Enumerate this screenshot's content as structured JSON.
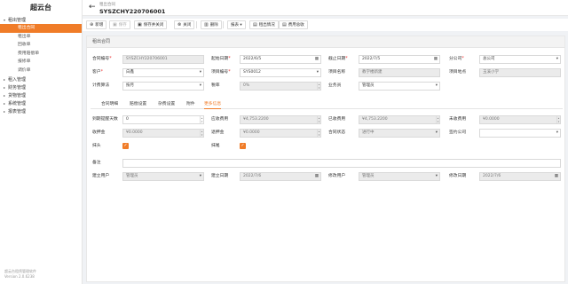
{
  "app": {
    "title": "超云台",
    "footer_line1": "超云台租赁管理软件",
    "footer_line2": "Version 2.0.6238"
  },
  "sidebar": {
    "groups": [
      {
        "label": "租出管理",
        "expanded": true
      },
      {
        "label": "租入管理",
        "expanded": false
      },
      {
        "label": "财务管理",
        "expanded": false
      },
      {
        "label": "货物管理",
        "expanded": false
      },
      {
        "label": "系统管理",
        "expanded": false
      },
      {
        "label": "报表管理",
        "expanded": false
      }
    ],
    "items": [
      {
        "label": "租出合同",
        "active": true
      },
      {
        "label": "租出单"
      },
      {
        "label": "回收单"
      },
      {
        "label": "费用赔偿单"
      },
      {
        "label": "报修单"
      },
      {
        "label": "调价单"
      }
    ]
  },
  "header": {
    "breadcrumb": "租出合同",
    "doc_no": "SYSZCHY220706001",
    "back_icon": "arrow-left-icon"
  },
  "toolbar": {
    "new": "新增",
    "save": "保存",
    "save_close": "保存并关闭",
    "close": "关闭",
    "delete": "删除",
    "print": "报表",
    "rent_status": "租出情况",
    "fee_summary": "费用总收"
  },
  "section_title": "租出合同",
  "form": {
    "contract_no_label": "合同编号",
    "contract_no": "SYSZCHY220706001",
    "start_date_label": "起始日期",
    "start_date": "2022/6/5",
    "end_date_label": "截止日期",
    "end_date": "2022/7/5",
    "branch_label": "分公司",
    "branch": "总公司",
    "customer_label": "客户",
    "customer": "白鑫",
    "project_no_label": "项目编号",
    "project_no": "SYS0012",
    "project_name_label": "项目名称",
    "project_name": "教学楼新建",
    "project_site_label": "项目地点",
    "project_site": "玉溪小学",
    "billing_label": "计费算法",
    "billing": "按月",
    "tax_label": "税率",
    "tax": "0%",
    "salesman_label": "业务员",
    "salesman": "管理员"
  },
  "tabs": [
    "合同明细",
    "赔偿设置",
    "杂费设置",
    "附件",
    "更多信息"
  ],
  "active_tab": 4,
  "more": {
    "reminder_days_label": "到期提醒天数",
    "reminder_days": "0",
    "receivable_label": "应收费用",
    "receivable": "¥4,753.2200",
    "received_label": "已收费用",
    "received": "¥4,753.2200",
    "unreceived_label": "未收费用",
    "unreceived": "¥0.0000",
    "deposit_in_label": "收押金",
    "deposit_in": "¥0.0000",
    "deposit_back_label": "退押金",
    "deposit_back": "¥0.0000",
    "status_label": "合同状态",
    "status": "进行中",
    "company_label": "签约公司",
    "company": "",
    "round_label": "抹头",
    "round_checked": true,
    "ceil_label": "抹尾",
    "ceil_checked": true,
    "remark_label": "备注",
    "remark": "",
    "creator_label": "建立用户",
    "creator": "管理员",
    "created_label": "建立日期",
    "created": "2022/7/6",
    "modifier_label": "修改用户",
    "modifier": "管理员",
    "modified_label": "修改日期",
    "modified": "2022/7/6"
  },
  "colors": {
    "accent": "#f07c28"
  }
}
